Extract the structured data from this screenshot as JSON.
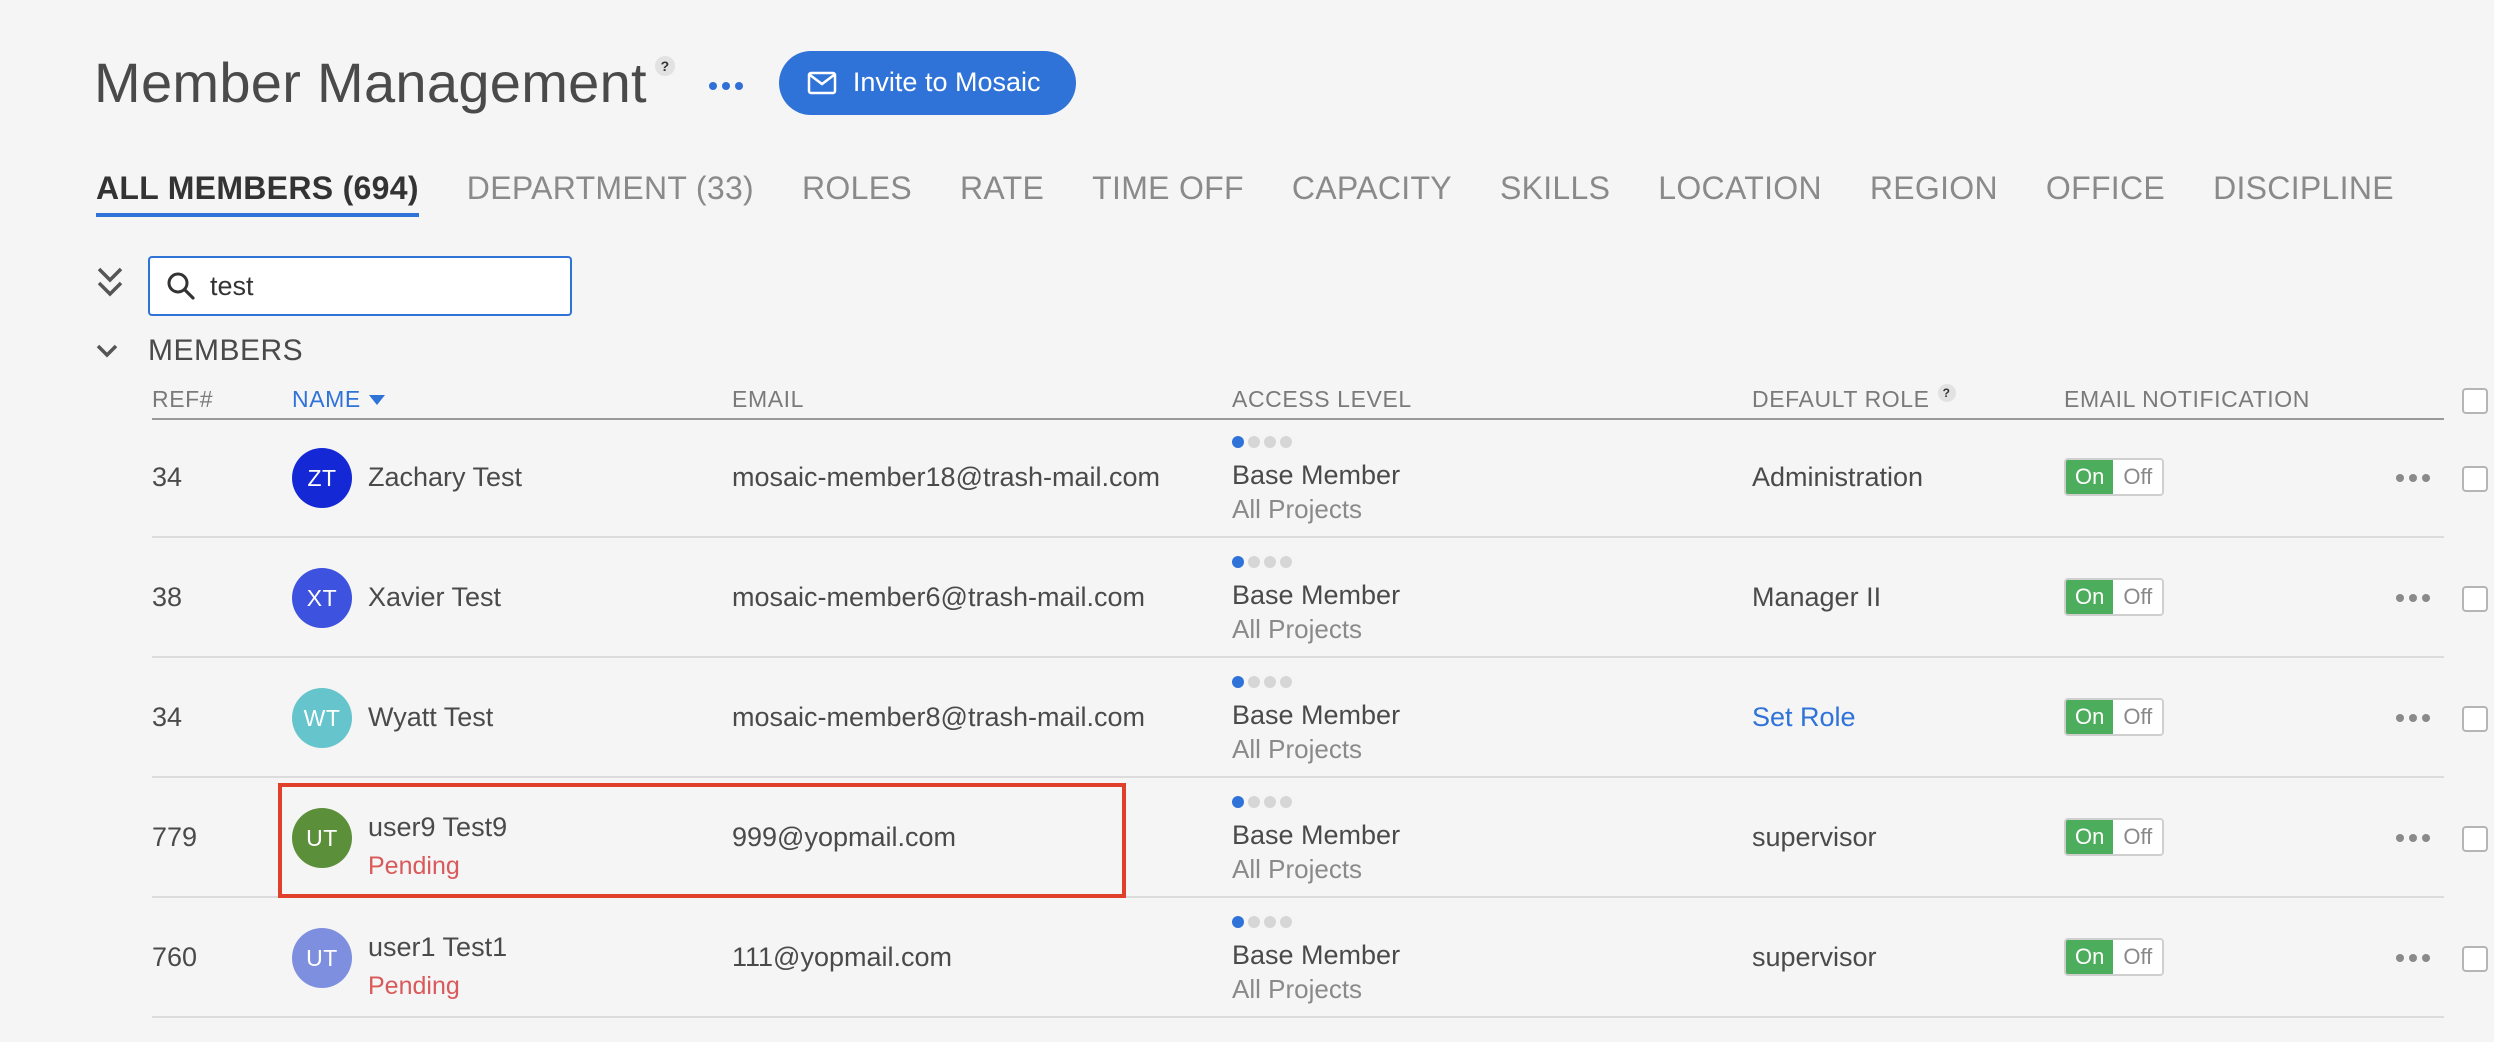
{
  "header": {
    "title": "Member Management",
    "help": "?",
    "invite_label": "Invite to Mosaic"
  },
  "tabs": [
    {
      "label": "ALL MEMBERS (694)",
      "active": true
    },
    {
      "label": "DEPARTMENT (33)"
    },
    {
      "label": "ROLES"
    },
    {
      "label": "RATE"
    },
    {
      "label": "TIME OFF"
    },
    {
      "label": "CAPACITY"
    },
    {
      "label": "SKILLS"
    },
    {
      "label": "LOCATION"
    },
    {
      "label": "REGION"
    },
    {
      "label": "OFFICE"
    },
    {
      "label": "DISCIPLINE"
    }
  ],
  "search": {
    "value": "test"
  },
  "section": {
    "title": "MEMBERS"
  },
  "columns": {
    "ref": "REF#",
    "name": "NAME",
    "email": "EMAIL",
    "access": "ACCESS LEVEL",
    "role": "DEFAULT ROLE",
    "role_help": "?",
    "notification": "EMAIL NOTIFICATION"
  },
  "toggle": {
    "on": "On",
    "off": "Off"
  },
  "colors": {
    "accent": "#2f72d8",
    "toggle_on": "#4cae5c",
    "pending": "#d95a5a",
    "highlight": "#e0402a"
  },
  "rows": [
    {
      "ref": "34",
      "initials": "ZT",
      "avatar_color": "#1428d6",
      "name": "Zachary Test",
      "pending": "",
      "email": "mosaic-member18@trash-mail.com",
      "access_level": "Base Member",
      "access_scope": "All Projects",
      "access_rank": 1,
      "role": "Administration",
      "role_is_link": false,
      "notification": "On"
    },
    {
      "ref": "38",
      "initials": "XT",
      "avatar_color": "#3e52e0",
      "name": "Xavier Test",
      "pending": "",
      "email": "mosaic-member6@trash-mail.com",
      "access_level": "Base Member",
      "access_scope": "All Projects",
      "access_rank": 1,
      "role": "Manager II",
      "role_is_link": false,
      "notification": "On"
    },
    {
      "ref": "34",
      "initials": "WT",
      "avatar_color": "#66c4cc",
      "name": "Wyatt Test",
      "pending": "",
      "email": "mosaic-member8@trash-mail.com",
      "access_level": "Base Member",
      "access_scope": "All Projects",
      "access_rank": 1,
      "role": "Set Role",
      "role_is_link": true,
      "notification": "On"
    },
    {
      "ref": "779",
      "initials": "UT",
      "avatar_color": "#5c8f3a",
      "name": "user9 Test9",
      "pending": "Pending",
      "email": "999@yopmail.com",
      "access_level": "Base Member",
      "access_scope": "All Projects",
      "access_rank": 1,
      "role": "supervisor",
      "role_is_link": false,
      "notification": "On"
    },
    {
      "ref": "760",
      "initials": "UT",
      "avatar_color": "#7f8fe0",
      "name": "user1 Test1",
      "pending": "Pending",
      "email": "111@yopmail.com",
      "access_level": "Base Member",
      "access_scope": "All Projects",
      "access_rank": 1,
      "role": "supervisor",
      "role_is_link": false,
      "notification": "On"
    }
  ]
}
